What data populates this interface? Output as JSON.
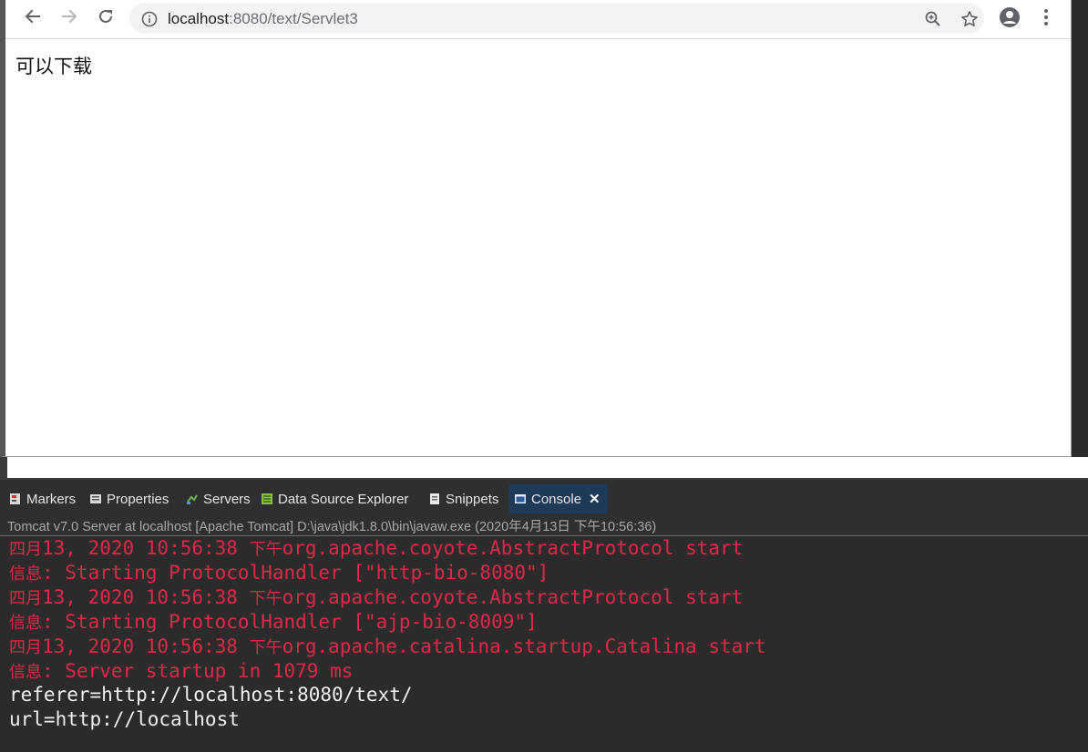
{
  "browser": {
    "url_host": "localhost",
    "url_rest": ":8080/text/Servlet3",
    "page_text": "可以下载",
    "icons": [
      "back-arrow-icon",
      "forward-arrow-icon",
      "reload-icon",
      "info-icon",
      "zoom-icon",
      "star-icon",
      "account-icon",
      "menu-dots-icon"
    ]
  },
  "ide": {
    "tabs": [
      {
        "label": "Markers",
        "icon": "markers-icon"
      },
      {
        "label": "Properties",
        "icon": "properties-icon"
      },
      {
        "label": "Servers",
        "icon": "servers-icon"
      },
      {
        "label": "Data Source Explorer",
        "icon": "data-source-icon"
      },
      {
        "label": "Snippets",
        "icon": "snippets-icon"
      },
      {
        "label": "Console",
        "icon": "console-icon",
        "active": true
      }
    ],
    "close_symbol": "✕",
    "status": "Tomcat v7.0 Server at localhost [Apache Tomcat] D:\\java\\jdk1.8.0\\bin\\javaw.exe  (2020年4月13日 下午10:56:36)",
    "console_lines": [
      {
        "prefix": "四月",
        "text": "13, 2020 10:56:38 ",
        "mid": "下午",
        "rest": "org.apache.coyote.AbstractProtocol start",
        "color": "red"
      },
      {
        "prefix": "信息",
        "text": ": Starting ProtocolHandler [\"http-bio-8080\"]",
        "color": "red"
      },
      {
        "prefix": "四月",
        "text": "13, 2020 10:56:38 ",
        "mid": "下午",
        "rest": "org.apache.coyote.AbstractProtocol start",
        "color": "red"
      },
      {
        "prefix": "信息",
        "text": ": Starting ProtocolHandler [\"ajp-bio-8009\"]",
        "color": "red"
      },
      {
        "prefix": "四月",
        "text": "13, 2020 10:56:38 ",
        "mid": "下午",
        "rest": "org.apache.catalina.startup.Catalina start",
        "color": "red"
      },
      {
        "prefix": "信息",
        "text": ": Server startup in 1079 ms",
        "color": "red"
      },
      {
        "text": "referer=http://localhost:8080/text/",
        "color": "white"
      },
      {
        "text": "url=http://localhost",
        "color": "white"
      }
    ]
  }
}
